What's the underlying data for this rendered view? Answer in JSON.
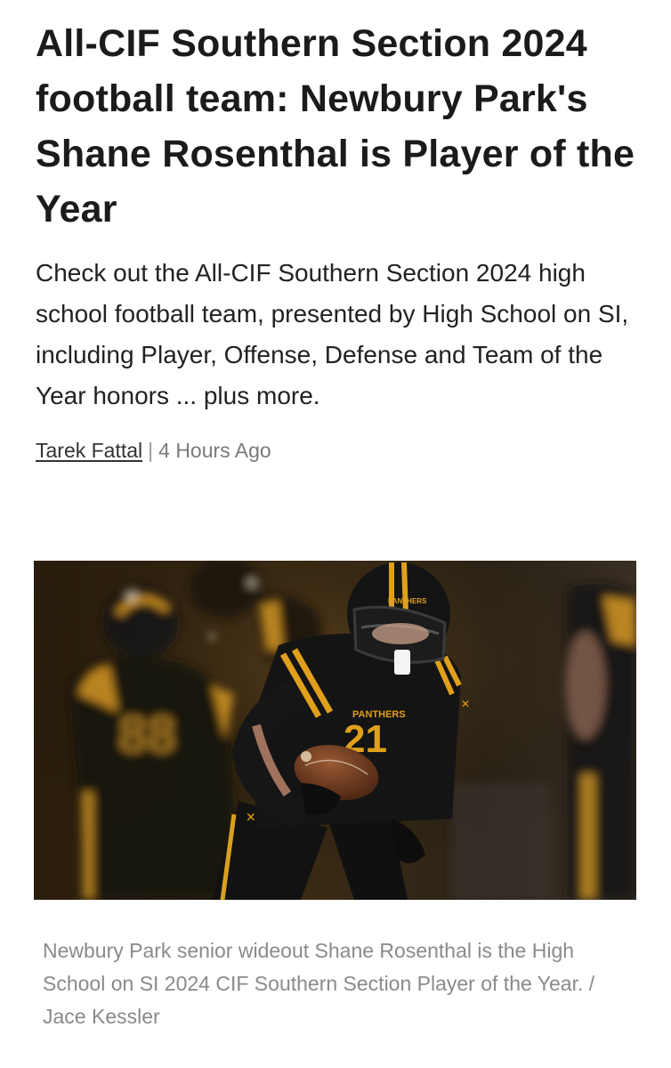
{
  "article": {
    "headline": "All-CIF Southern Section 2024 football team: Newbury Park's Shane Rosenthal is Player of the Year",
    "dek": "Check out the All-CIF Southern Section 2024 high school football team, presented by High School on SI, including Player, Offense, Defense and Team of the Year honors ... plus more.",
    "author": "Tarek Fattal",
    "separator": "|",
    "timestamp": "4 Hours Ago"
  },
  "photo": {
    "helmet_text": "PANTHERS",
    "jersey_text": "PANTHERS",
    "jersey_number": "21",
    "caption": "Newbury Park senior wideout Shane Rosenthal is the High School on SI 2024 CIF Southern Section Player of the Year. / Jace Kessler"
  },
  "colors": {
    "team_gold": "#e0a01c",
    "team_black": "#141414",
    "caption_gray": "#8a8a8a"
  }
}
